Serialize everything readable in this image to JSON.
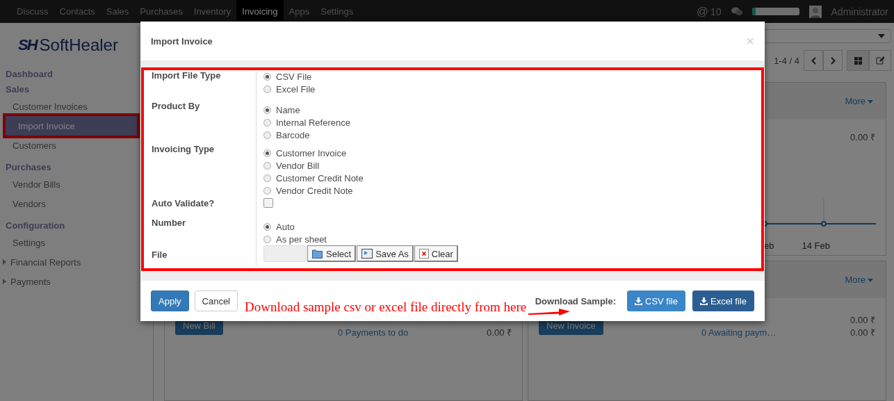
{
  "navbar": {
    "menu": [
      {
        "label": "Discuss",
        "selected": false
      },
      {
        "label": "Contacts",
        "selected": false
      },
      {
        "label": "Sales",
        "selected": false
      },
      {
        "label": "Purchases",
        "selected": false
      },
      {
        "label": "Inventory",
        "selected": false
      },
      {
        "label": "Invoicing",
        "selected": true
      },
      {
        "label": "Apps",
        "selected": false
      },
      {
        "label": "Settings",
        "selected": false
      }
    ],
    "mention_symbol": "@",
    "mentions": "10",
    "progress": {
      "level": 0.08
    },
    "user": "Administrator"
  },
  "sidebar": {
    "logo_mark": "SH",
    "logo_text": "SoftHealer",
    "sections": [
      {
        "title": "Dashboard"
      },
      {
        "title": "Sales",
        "items": [
          {
            "label": "Customer Invoices",
            "kind": "link",
            "selected": false
          },
          {
            "label": "Import Invoice",
            "kind": "link",
            "selected": true
          },
          {
            "label": "Customers",
            "kind": "link",
            "selected": false
          }
        ]
      },
      {
        "title": "Purchases",
        "items": [
          {
            "label": "Vendor Bills",
            "kind": "link",
            "selected": false
          },
          {
            "label": "Vendors",
            "kind": "link",
            "selected": false
          }
        ]
      },
      {
        "title": "Configuration",
        "items": [
          {
            "label": "Settings",
            "kind": "link",
            "selected": false
          },
          {
            "label": "Financial Reports",
            "kind": "group",
            "selected": false
          },
          {
            "label": "Payments",
            "kind": "group",
            "selected": false
          }
        ]
      }
    ]
  },
  "main": {
    "pager": "1-4 / 4",
    "cards": [
      {
        "kind": "dashboard",
        "more": "More",
        "rows": [
          {
            "amount": "0.00 ₹"
          }
        ],
        "chart_labels": [
          "eb",
          "14 Feb"
        ]
      },
      {
        "kind": "dashboard",
        "button": "New Bill",
        "rows": [
          {
            "label": "0 Payments to do",
            "amount": "0.00 ₹"
          }
        ]
      },
      {
        "kind": "dashboard",
        "more": "More",
        "button": "New Invoice",
        "rows": [
          {
            "amount": "0.00 ₹"
          },
          {
            "label": "0 Awaiting paym…",
            "amount": "0.00 ₹"
          }
        ]
      }
    ]
  },
  "dialog": {
    "title": "Import Invoice",
    "close": "×",
    "fields": [
      {
        "label": "Import File Type",
        "kind": "radio",
        "options": [
          {
            "label": "CSV File",
            "selected": true
          },
          {
            "label": "Excel File",
            "selected": false
          }
        ]
      },
      {
        "label": "Product By",
        "kind": "radio",
        "options": [
          {
            "label": "Name",
            "selected": true
          },
          {
            "label": "Internal Reference",
            "selected": false
          },
          {
            "label": "Barcode",
            "selected": false
          }
        ]
      },
      {
        "label": "Invoicing Type",
        "kind": "radio",
        "options": [
          {
            "label": "Customer Invoice",
            "selected": true
          },
          {
            "label": "Vendor Bill",
            "selected": false
          },
          {
            "label": "Customer Credit Note",
            "selected": false
          },
          {
            "label": "Vendor Credit Note",
            "selected": false
          }
        ]
      },
      {
        "label": "Auto Validate?",
        "kind": "checkbox",
        "checked": false
      },
      {
        "label": "Number",
        "kind": "radio",
        "options": [
          {
            "label": "Auto",
            "selected": true
          },
          {
            "label": "As per sheet",
            "selected": false
          }
        ]
      },
      {
        "label": "File",
        "kind": "file",
        "buttons": [
          {
            "label": "Select",
            "kind": "folder"
          },
          {
            "label": "Save As",
            "kind": "save"
          },
          {
            "label": "Clear",
            "kind": "clear"
          }
        ]
      }
    ],
    "apply": "Apply",
    "cancel": "Cancel",
    "note": "Download sample csv or excel file directly from here",
    "download_label": "Download Sample:",
    "downloads": [
      {
        "label": "CSV file",
        "kind": "primary"
      },
      {
        "label": "Excel file",
        "kind": "dark"
      }
    ]
  }
}
